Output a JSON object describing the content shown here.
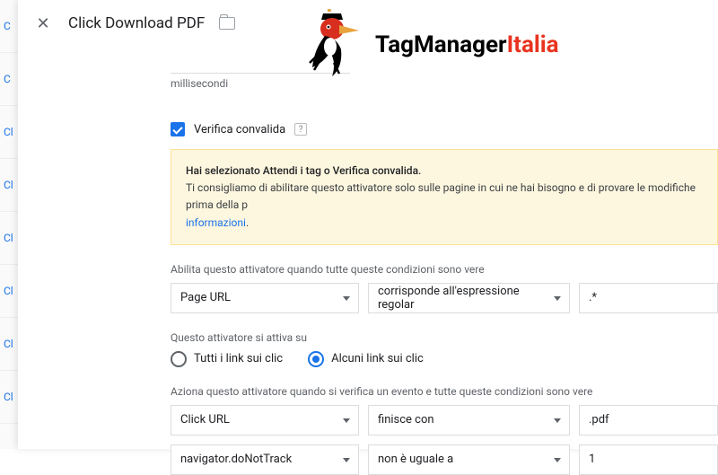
{
  "page": {
    "title": "Click Download PDF"
  },
  "ms": {
    "label": "millisecondi"
  },
  "verify": {
    "label": "Verifica convalida",
    "help": "?"
  },
  "warn": {
    "bold": "Hai selezionato Attendi i tag o Verifica convalida.",
    "text": "Ti consigliamo di abilitare questo attivatore solo sulle pagine in cui ne hai bisogno e di provare le modifiche prima della p",
    "link": "informazioni"
  },
  "enable": {
    "label": "Abilita questo attivatore quando tutte queste condizioni sono vere",
    "var": "Page URL",
    "op": "corrisponde all'espressione regolar",
    "val": ".*"
  },
  "fires": {
    "label": "Questo attivatore si attiva su",
    "all": "Tutti i link sui clic",
    "some": "Alcuni link sui clic"
  },
  "action": {
    "label": "Aziona questo attivatore quando si verifica un evento e tutte queste condizioni sono vere",
    "r1": {
      "var": "Click URL",
      "op": "finisce con",
      "val": ".pdf"
    },
    "r2": {
      "var": "navigator.doNotTrack",
      "op": "non è uguale a",
      "val": "1"
    }
  },
  "brand": {
    "a": "TagManager",
    "b": "Italia"
  }
}
